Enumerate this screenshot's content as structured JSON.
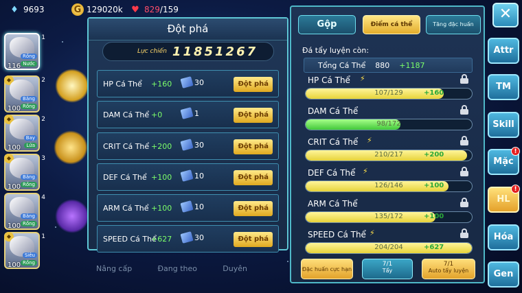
{
  "resources": {
    "gems": "9693",
    "gold": "129020k",
    "stamina_current": "829",
    "stamina_max": "/159"
  },
  "pets": [
    {
      "level": "116",
      "tag1": "Rồng",
      "tag2": "Nước",
      "num": "1"
    },
    {
      "level": "100",
      "tag1": "Băng",
      "tag2": "Rồng",
      "num": "2"
    },
    {
      "level": "100",
      "tag1": "Bay",
      "tag2": "Lửa",
      "num": "2"
    },
    {
      "level": "100",
      "tag1": "Băng",
      "tag2": "Rồng",
      "num": "3"
    },
    {
      "level": "100",
      "tag1": "Băng",
      "tag2": "Rồng",
      "num": "4"
    },
    {
      "level": "100",
      "tag1": "Siêu",
      "tag2": "Rồng",
      "num": "1"
    }
  ],
  "breakthrough": {
    "title": "Đột phá",
    "power_label": "Lực chiến",
    "power_value": "11851267",
    "rows": [
      {
        "stat": "HP Cá Thể",
        "plus": "+160",
        "cost": "30",
        "button": "Đột phá"
      },
      {
        "stat": "DAM Cá Thể",
        "plus": "+0",
        "cost": "1",
        "button": "Đột phá"
      },
      {
        "stat": "CRIT Cá Thể",
        "plus": "+200",
        "cost": "30",
        "button": "Đột phá"
      },
      {
        "stat": "DEF Cá Thể",
        "plus": "+100",
        "cost": "10",
        "button": "Đột phá"
      },
      {
        "stat": "ARM Cá Thể",
        "plus": "+100",
        "cost": "10",
        "button": "Đột phá"
      },
      {
        "stat": "SPEED Cá Thể",
        "plus": "+627",
        "cost": "30",
        "button": "Đột phá"
      }
    ]
  },
  "bottom_tabs": [
    "Nâng cấp",
    "Đang theo",
    "Duyên"
  ],
  "right": {
    "tabs": {
      "gop": "Gộp",
      "diem": "Điểm cá thể",
      "tang": "Tăng đặc huấn"
    },
    "subheader": "Đá tẩy luyện còn:",
    "total_label": "Tổng Cá Thể",
    "total_value": "880",
    "total_plus": "+1187",
    "stats": [
      {
        "name": "HP Cá Thể",
        "value": "107/129",
        "gain": "+160",
        "progress": 0.83,
        "color": "yellow"
      },
      {
        "name": "DAM Cá Thể",
        "value": "98/172",
        "gain": "",
        "progress": 0.57,
        "color": "green"
      },
      {
        "name": "CRIT Cá Thể",
        "value": "210/217",
        "gain": "+200",
        "progress": 0.97,
        "color": "yellow"
      },
      {
        "name": "DEF Cá Thể",
        "value": "126/146",
        "gain": "+100",
        "progress": 0.86,
        "color": "yellow"
      },
      {
        "name": "ARM Cá Thể",
        "value": "135/172",
        "gain": "+100",
        "progress": 0.78,
        "color": "yellow"
      },
      {
        "name": "SPEED Cá Thể",
        "value": "204/204",
        "gain": "+627",
        "progress": 1.0,
        "color": "yellow"
      }
    ],
    "buttons": {
      "dac_huan": "Đặc huấn cực hạn",
      "tay_count": "7/1",
      "tay_label": "Tẩy",
      "auto_count": "7/1",
      "auto_label": "Auto tẩy luyện"
    }
  },
  "nav": [
    {
      "label": "Attr",
      "badge": ""
    },
    {
      "label": "TM",
      "badge": ""
    },
    {
      "label": "Skill",
      "badge": ""
    },
    {
      "label": "Mặc",
      "badge": "!"
    },
    {
      "label": "HL",
      "badge": "!"
    },
    {
      "label": "Hóa",
      "badge": ""
    },
    {
      "label": "Gen",
      "badge": ""
    }
  ],
  "close_label": "✕"
}
